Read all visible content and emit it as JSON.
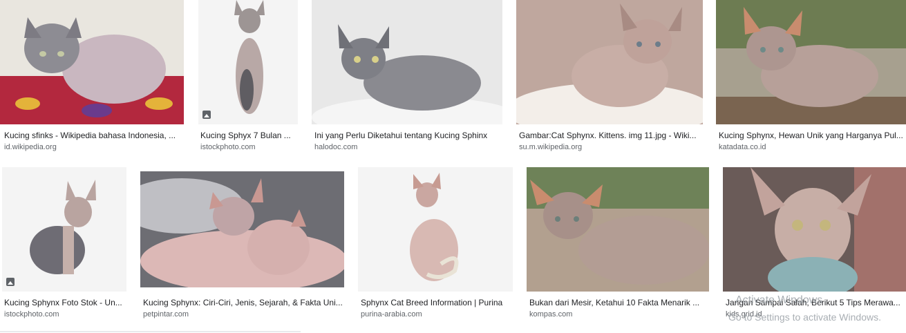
{
  "results": [
    {
      "title": "Kucing sfinks - Wikipedia bahasa Indonesia, ...",
      "source": "id.wikipedia.org"
    },
    {
      "title": "Kucing Sphyx 7 Bulan ...",
      "source": "istockphoto.com"
    },
    {
      "title": "Ini yang Perlu Diketahui tentang Kucing Sphinx",
      "source": "halodoc.com"
    },
    {
      "title": "Gambar:Cat Sphynx. Kittens. img 11.jpg - Wiki...",
      "source": "su.m.wikipedia.org"
    },
    {
      "title": "Kucing Sphynx, Hewan Unik yang Harganya Pul...",
      "source": "katadata.co.id"
    },
    {
      "title": "Kucing Sphynx Foto Stok - Un...",
      "source": "istockphoto.com"
    },
    {
      "title": "Kucing Sphynx: Ciri-Ciri, Jenis, Sejarah, & Fakta Uni...",
      "source": "petpintar.com"
    },
    {
      "title": "Sphynx Cat Breed Information | Purina",
      "source": "purina-arabia.com"
    },
    {
      "title": "Bukan dari Mesir, Ketahui 10 Fakta Menarik ...",
      "source": "kompas.com"
    },
    {
      "title": "Jangan Sampai Salah, Berikut 5 Tips Merawa...",
      "source": "kids.grid.id"
    }
  ],
  "overlay": {
    "activate_title": "Activate Windows",
    "activate_sub": "Go to Settings to activate Windows."
  },
  "icons": {
    "stock_badge": "image-icon"
  }
}
